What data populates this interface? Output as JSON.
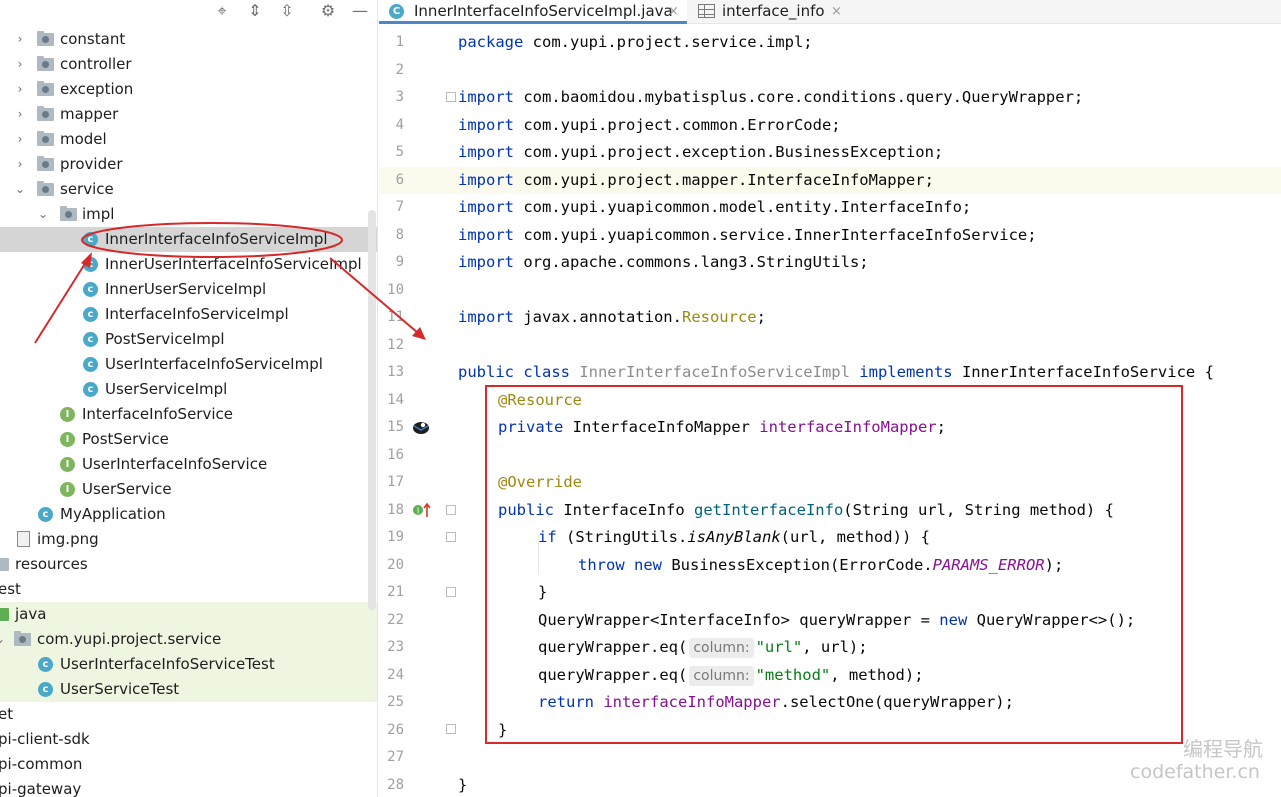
{
  "project_tree": {
    "toolbar_icons": [
      "target-icon",
      "expand-all-icon",
      "collapse-all-icon",
      "gear-icon",
      "minimize-icon"
    ],
    "items": [
      {
        "label": "constant",
        "icon": "folder-package-icon",
        "expander": "›"
      },
      {
        "label": "controller",
        "icon": "folder-package-icon",
        "expander": "›"
      },
      {
        "label": "exception",
        "icon": "folder-package-icon",
        "expander": "›"
      },
      {
        "label": "mapper",
        "icon": "folder-package-icon",
        "expander": "›"
      },
      {
        "label": "model",
        "icon": "folder-package-icon",
        "expander": "›"
      },
      {
        "label": "provider",
        "icon": "folder-package-icon",
        "expander": "›"
      },
      {
        "label": "service",
        "icon": "folder-package-icon",
        "expander": "⌄"
      },
      {
        "label": "impl",
        "icon": "folder-package-icon",
        "expander": "⌄"
      },
      {
        "label": "InnerInterfaceInfoServiceImpl",
        "icon": "class-icon",
        "selected": true
      },
      {
        "label": "InnerUserInterfaceInfoServiceImpl",
        "icon": "class-icon"
      },
      {
        "label": "InnerUserServiceImpl",
        "icon": "class-icon"
      },
      {
        "label": "InterfaceInfoServiceImpl",
        "icon": "class-icon"
      },
      {
        "label": "PostServiceImpl",
        "icon": "class-icon"
      },
      {
        "label": "UserInterfaceInfoServiceImpl",
        "icon": "class-icon"
      },
      {
        "label": "UserServiceImpl",
        "icon": "class-icon"
      },
      {
        "label": "InterfaceInfoService",
        "icon": "interface-icon"
      },
      {
        "label": "PostService",
        "icon": "interface-icon"
      },
      {
        "label": "UserInterfaceInfoService",
        "icon": "interface-icon"
      },
      {
        "label": "UserService",
        "icon": "interface-icon"
      },
      {
        "label": "MyApplication",
        "icon": "spring-boot-class-icon"
      },
      {
        "label": "img.png",
        "icon": "image-file-icon"
      },
      {
        "label": "resources",
        "icon": "resources-folder-icon"
      },
      {
        "label": "est",
        "icon": ""
      },
      {
        "label": "java",
        "icon": "test-source-folder-icon"
      },
      {
        "label": "com.yupi.project.service",
        "icon": "folder-package-icon",
        "expander": "⌄"
      },
      {
        "label": "UserInterfaceInfoServiceTest",
        "icon": "test-class-icon"
      },
      {
        "label": "UserServiceTest",
        "icon": "test-class-icon"
      },
      {
        "label": "et",
        "icon": ""
      },
      {
        "label": "pi-client-sdk",
        "icon": ""
      },
      {
        "label": "pi-common",
        "icon": ""
      },
      {
        "label": "pi-gateway",
        "icon": ""
      }
    ]
  },
  "editor": {
    "tabs": [
      {
        "label": "InnerInterfaceInfoServiceImpl.java",
        "icon": "class-icon",
        "icon_letter": "C",
        "active": true,
        "close": "×"
      },
      {
        "label": "interface_info",
        "icon": "table-icon",
        "active": false,
        "close": "×"
      }
    ],
    "current_line": 6,
    "line_numbers": [
      "1",
      "2",
      "3",
      "4",
      "5",
      "6",
      "7",
      "8",
      "9",
      "10",
      "11",
      "12",
      "13",
      "14",
      "15",
      "16",
      "17",
      "18",
      "19",
      "20",
      "21",
      "22",
      "23",
      "24",
      "25",
      "26",
      "27",
      "28"
    ],
    "code": {
      "l1": {
        "kw": "package",
        "rest": " com.yupi.project.service.impl;"
      },
      "l3": {
        "kw": "import",
        "rest": " com.baomidou.mybatisplus.core.conditions.query.QueryWrapper;"
      },
      "l4": {
        "kw": "import",
        "rest": " com.yupi.project.common.ErrorCode;"
      },
      "l5": {
        "kw": "import",
        "rest": " com.yupi.project.exception.BusinessException;"
      },
      "l6": {
        "kw": "import",
        "rest": " com.yupi.project.mapper.InterfaceInfoMapper;"
      },
      "l7": {
        "kw": "import",
        "rest": " com.yupi.yuapicommon.model.entity.InterfaceInfo;"
      },
      "l8": {
        "kw": "import",
        "rest": " com.yupi.yuapicommon.service.InnerInterfaceInfoService;"
      },
      "l9": {
        "kw": "import",
        "rest": " org.apache.commons.lang3.StringUtils;"
      },
      "l11": {
        "kw": "import",
        "pkg": " javax.annotation.",
        "ann": "Resource",
        "end": ";"
      },
      "l13": {
        "kw1": "public class",
        "cls": " InnerInterfaceInfoServiceImpl",
        "kw2": " implements",
        "rest": " InnerInterfaceInfoService {"
      },
      "l14": {
        "ann": "@Resource"
      },
      "l15": {
        "kw": "private",
        "type": " InterfaceInfoMapper",
        "field": " interfaceInfoMapper",
        "end": ";"
      },
      "l17": {
        "ann": "@Override"
      },
      "l18": {
        "kw": "public",
        "type": " InterfaceInfo",
        "method": " getInterfaceInfo",
        "rest": "(String url, String method) {"
      },
      "l19": {
        "kw": "if",
        "pre": " (StringUtils.",
        "call": "isAnyBlank",
        "rest": "(url, method)) {"
      },
      "l20": {
        "kw1": "throw",
        "kw2": " new",
        "pre": " BusinessException(ErrorCode.",
        "const": "PARAMS_ERROR",
        "end": ");"
      },
      "l21": {
        "text": "}"
      },
      "l22": {
        "pre": "QueryWrapper<InterfaceInfo> queryWrapper = ",
        "kw": "new",
        "rest": " QueryWrapper<>();"
      },
      "l23": {
        "pre": "queryWrapper.eq(",
        "hint": "column:",
        "str": "\"url\"",
        "rest": ", url);"
      },
      "l24": {
        "pre": "queryWrapper.eq(",
        "hint": "column:",
        "str": "\"method\"",
        "rest": ", method);"
      },
      "l25": {
        "kw": "return",
        "field": " interfaceInfoMapper",
        "rest": ".selectOne(queryWrapper);"
      },
      "l26": {
        "text": "}"
      },
      "l28": {
        "text": "}"
      }
    },
    "gutter_icons": {
      "l15": "mybatis-bird-icon",
      "l18": "implements-method-icon"
    }
  },
  "annotation": {
    "highlight_color": "#d62a2a"
  },
  "watermark": {
    "line1": "编程导航",
    "line2": "codefather.cn"
  }
}
